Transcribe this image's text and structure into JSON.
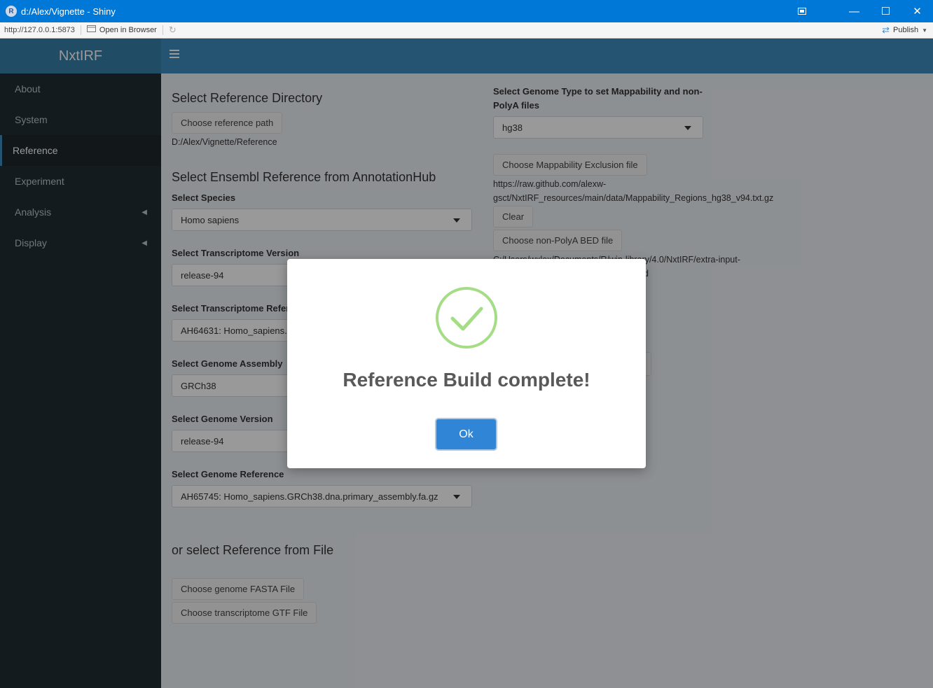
{
  "window": {
    "title": "d:/Alex/Vignette - Shiny",
    "app_icon": "R",
    "minimize": "—",
    "maximize": "☐",
    "close": "✕"
  },
  "toolbar": {
    "url": "http://127.0.0.1:5873",
    "open_in_browser": "Open in Browser",
    "publish": "Publish"
  },
  "app": {
    "logo": "NxtIRF",
    "menu": [
      {
        "label": "About",
        "active": false
      },
      {
        "label": "System",
        "active": false
      },
      {
        "label": "Reference",
        "active": true
      },
      {
        "label": "Experiment",
        "active": false
      },
      {
        "label": "Analysis",
        "active": false
      },
      {
        "label": "Display",
        "active": false
      }
    ]
  },
  "left": {
    "ref_dir_heading": "Select Reference Directory",
    "choose_ref_path": "Choose reference path",
    "ref_path_value": "D:/Alex/Vignette/Reference",
    "ensembl_heading": "Select Ensembl Reference from AnnotationHub",
    "species_label": "Select Species",
    "species_value": "Homo sapiens",
    "tx_version_label": "Select Transcriptome Version",
    "tx_version_value": "release-94",
    "tx_ref_label": "Select Transcriptome Refer",
    "tx_ref_value": "AH64631: Homo_sapiens.G",
    "assembly_label": "Select Genome Assembly",
    "assembly_value": "GRCh38",
    "genome_version_label": "Select Genome Version",
    "genome_version_value": "release-94",
    "genome_ref_label": "Select Genome Reference",
    "genome_ref_value": "AH65745: Homo_sapiens.GRCh38.dna.primary_assembly.fa.gz",
    "from_file_heading": "or select Reference from File",
    "choose_fasta": "Choose genome FASTA File",
    "choose_gtf": "Choose transcriptome GTF File"
  },
  "right": {
    "genome_type_label_1": "Select Genome Type to set Mappability and non-",
    "genome_type_label_2": "PolyA files",
    "genome_type_value": "hg38",
    "choose_mappability": "Choose Mappability Exclusion file",
    "mappability_path_1": "https://raw.github.com/alexw-",
    "mappability_path_2": "gsct/NxtIRF_resources/main/data/Mappability_Regions_hg38_v94.txt.gz",
    "clear": "Clear",
    "choose_nonpolya": "Choose non-PolyA BED file",
    "nonpolya_path_1": "C:/Users/wxlex/Documents/R/win-library/4.0/NxtIRF/extra-input-",
    "nonpolya_path_2": "d"
  },
  "modal": {
    "title": "Reference Build complete!",
    "ok": "Ok",
    "icon": "success-check-icon"
  }
}
